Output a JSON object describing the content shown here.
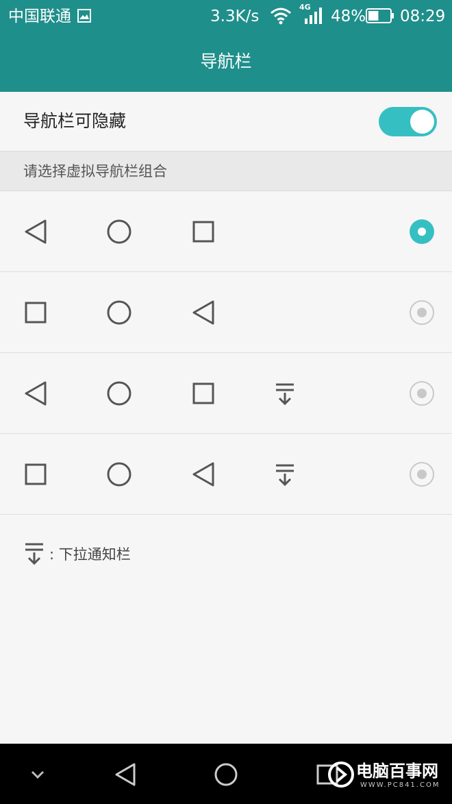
{
  "status_bar": {
    "carrier": "中国联通",
    "speed": "3.3K/s",
    "network_type": "4G",
    "battery_percent": "48%",
    "battery_level": 0.48,
    "time": "08:29",
    "icons": [
      "image-icon",
      "wifi-icon",
      "signal-icon",
      "battery-icon"
    ]
  },
  "title_bar": {
    "title": "导航栏"
  },
  "hide_toggle": {
    "label": "导航栏可隐藏",
    "on": true
  },
  "section": {
    "header": "请选择虚拟导航栏组合"
  },
  "options": [
    {
      "buttons": [
        "back",
        "home",
        "recent"
      ],
      "selected": true
    },
    {
      "buttons": [
        "recent",
        "home",
        "back"
      ],
      "selected": false
    },
    {
      "buttons": [
        "back",
        "home",
        "recent",
        "notification"
      ],
      "selected": false
    },
    {
      "buttons": [
        "recent",
        "home",
        "back",
        "notification"
      ],
      "selected": false
    }
  ],
  "legend": {
    "text": ": 下拉通知栏",
    "icon": "pull-down-notification-icon"
  },
  "system_nav": {
    "icons": [
      "chevron-down-icon",
      "back-icon",
      "home-icon",
      "recent-icon"
    ]
  },
  "watermark": {
    "brand": "电脑百事网",
    "site": "WWW.PC841.COM"
  },
  "colors": {
    "primary": "#1f8f8b",
    "accent": "#36bfc2",
    "icon_gray": "#555555",
    "radio_gray": "#c8c8c8"
  }
}
